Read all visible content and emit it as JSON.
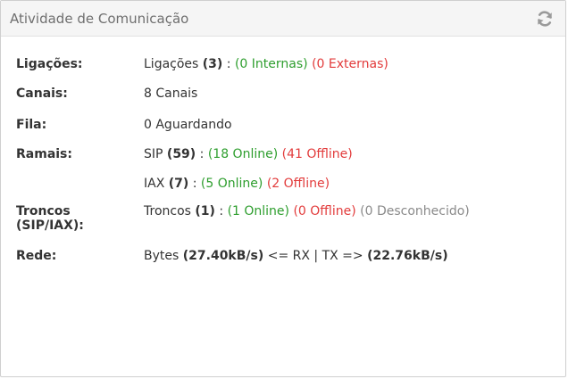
{
  "panel": {
    "title": "Atividade de Comunicação",
    "refresh_icon": "refresh-icon"
  },
  "rows": {
    "ligacoes": {
      "label": "Ligações:",
      "text": "Ligações",
      "count": "(3)",
      "sep": ":",
      "internas": "(0 Internas)",
      "externas": "(0 Externas)"
    },
    "canais": {
      "label": "Canais:",
      "value": "8 Canais"
    },
    "fila": {
      "label": "Fila:",
      "value": "0 Aguardando"
    },
    "ramais": {
      "label": "Ramais:",
      "sip": {
        "text": "SIP",
        "count": "(59)",
        "sep": ":",
        "online": "(18 Online)",
        "offline": "(41 Offline)"
      },
      "iax": {
        "text": "IAX",
        "count": "(7)",
        "sep": ":",
        "online": "(5 Online)",
        "offline": "(2 Offline)"
      }
    },
    "troncos": {
      "label_line1": "Troncos",
      "label_line2": "(SIP/IAX):",
      "text": "Troncos",
      "count": "(1)",
      "sep": ":",
      "online": "(1 Online)",
      "offline": "(0 Offline)",
      "unknown": "(0 Desconhecido)"
    },
    "rede": {
      "label": "Rede:",
      "bytes": "Bytes",
      "rx_value": "(27.40kB/s)",
      "middle": "<= RX | TX =>",
      "tx_value": "(22.76kB/s)"
    }
  },
  "colors": {
    "online": "#2e9e2e",
    "offline": "#e23b3b",
    "unknown": "#8a8a8a"
  }
}
